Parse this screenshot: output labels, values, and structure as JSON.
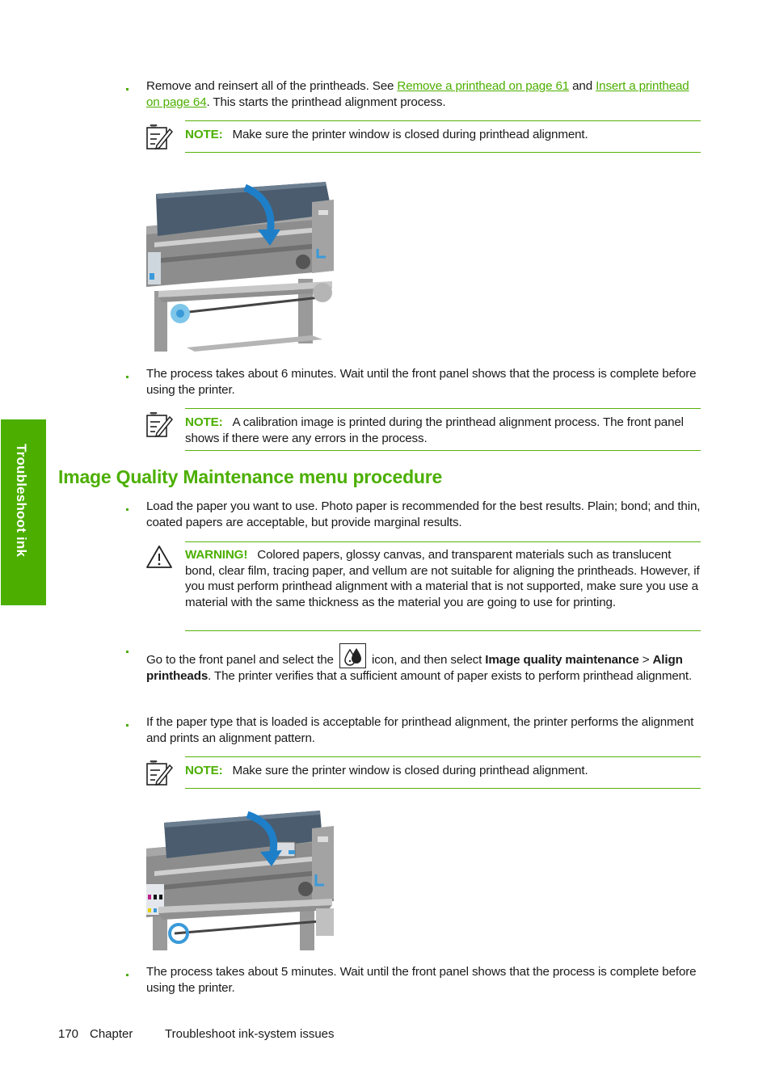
{
  "side_tab": {
    "label": "Troubleshoot ink"
  },
  "section_heading": "Image Quality Maintenance menu procedure",
  "steps_before": [
    {
      "text_pre": "Remove and reinsert all of the printheads. See ",
      "link1": "Remove a printhead on page 61",
      "text_mid": " and ",
      "link2": "Insert a printhead on page 64",
      "text_post": ". This starts the printhead alignment process."
    },
    {
      "text": "The process takes about 6 minutes. Wait until the front panel shows that the process is complete before using the printer."
    }
  ],
  "notes": [
    {
      "label": "NOTE:",
      "text": "Make sure the printer window is closed during printhead alignment."
    },
    {
      "label": "NOTE:",
      "text": "A calibration image is printed during the printhead alignment process. The front panel shows if there were any errors in the process."
    },
    {
      "label": "NOTE:",
      "text": "Make sure the printer window is closed during printhead alignment."
    }
  ],
  "warning": {
    "label": "WARNING!",
    "text": "Colored papers, glossy canvas, and transparent materials such as translucent bond, clear film, tracing paper, and vellum are not suitable for aligning the printheads. However, if you must perform printhead alignment with a material that is not supported, make sure you use a material with the same thickness as the material you are going to use for printing."
  },
  "steps_after": [
    {
      "text": "Load the paper you want to use. Photo paper is recommended for the best results. Plain; bond; and thin, coated papers are acceptable, but provide marginal results."
    },
    {
      "text_pre": "Go to the front panel and select the ",
      "icon": "ink-drops-icon",
      "text_mid": " icon, and then select ",
      "bold1": "Image quality maintenance",
      "sep": " > ",
      "bold2": "Align printheads",
      "text_post": ". The printer verifies that a sufficient amount of paper exists to perform printhead alignment."
    },
    {
      "text": "If the paper type that is loaded is acceptable for printhead alignment, the printer performs the alignment and prints an alignment pattern."
    },
    {
      "text": "The process takes about 5 minutes. Wait until the front panel shows that the process is complete before using the printer."
    }
  ],
  "images": [
    {
      "alt": "Printer window being closed (arrow indicating closing motion)"
    },
    {
      "alt": "Printer window being closed with carriage visible (arrow indicating closing motion)"
    }
  ],
  "footer": {
    "page_number": "170",
    "chapter": "Chapter",
    "title": "Troubleshoot ink-system issues"
  },
  "colors": {
    "accent": "#4caf00",
    "text": "#1a1a1a",
    "arrow": "#1e7fc8"
  }
}
